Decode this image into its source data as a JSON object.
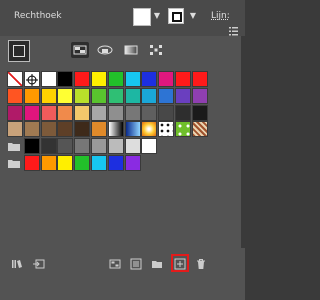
{
  "header": {
    "title": "Rechthoek",
    "stroke_label": "Lijn:"
  },
  "colors": {
    "panel": "#535353",
    "highlight": "#e21b1b"
  },
  "swatch_rows": [
    [
      "none",
      "registration",
      "#ffffff",
      "#000000",
      "#ff1a1a",
      "#ffef00",
      "#22c02a",
      "#17c6f0",
      "#1d2fe0",
      "#e0187e",
      "#ff1a1a",
      "#ff1a1a"
    ],
    [
      "#ff5522",
      "#ff9900",
      "#ffd200",
      "#ffff33",
      "#b9e02a",
      "#59c42e",
      "#2fbf74",
      "#1db7a3",
      "#1aa7d8",
      "#2d74d4",
      "#6a3fbf",
      "#8f3fb0"
    ],
    [
      "#b01a68",
      "#e0157d",
      "#f05b5b",
      "#f08a4b",
      "#f3c86b",
      "#a7a7a7",
      "#8f8f8f",
      "#777777",
      "#5f5f5f",
      "#484848",
      "#2e2e2e",
      "#1a1a1a"
    ],
    [
      "#c8a27a",
      "#a07a52",
      "#7d5a3a",
      "#5e3f27",
      "#3e2a1a",
      "#e08a2a",
      "gradient-bw",
      "gradient-blue",
      "gradient-orange",
      "pattern-dots",
      "pattern-green",
      "pattern-brown"
    ],
    [
      "folder",
      "#000000",
      "#333333",
      "#555555",
      "#777777",
      "#999999",
      "#bbbbbb",
      "#dddddd",
      "#ffffff"
    ],
    [
      "folder",
      "#ff1a1a",
      "#ff9900",
      "#ffef00",
      "#22c02a",
      "#17c6f0",
      "#1d2fe0",
      "#8a2be2"
    ]
  ],
  "icons": {
    "view_toggle": "list-view-icon",
    "bottom": [
      "swatch-libraries-icon",
      "import-icon",
      "show-kinds-icon",
      "swatch-options-icon",
      "new-color-group-icon",
      "new-swatch-icon",
      "delete-icon"
    ]
  }
}
